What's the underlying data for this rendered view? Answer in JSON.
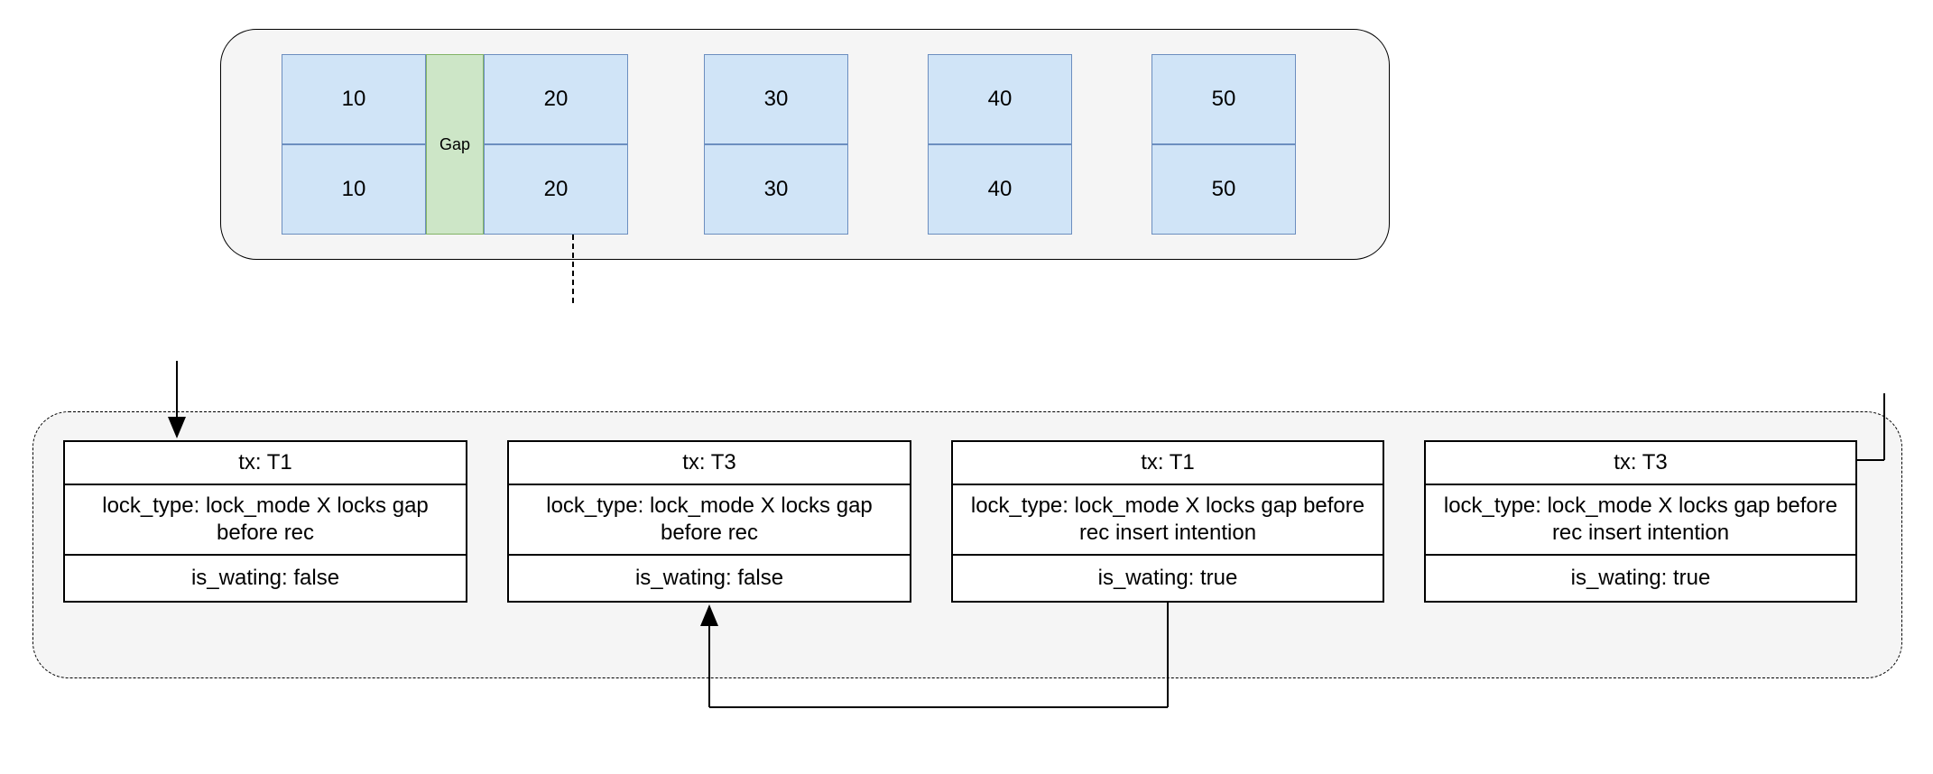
{
  "records": {
    "gap_label": "Gap",
    "columns": [
      {
        "top": "10",
        "bottom": "10"
      },
      {
        "top": "20",
        "bottom": "20"
      },
      {
        "top": "30",
        "bottom": "30"
      },
      {
        "top": "40",
        "bottom": "40"
      },
      {
        "top": "50",
        "bottom": "50"
      }
    ]
  },
  "locks": [
    {
      "tx": "tx: T1",
      "lock_type": "lock_type: lock_mode X locks gap before rec",
      "is_waiting": "is_wating: false"
    },
    {
      "tx": "tx: T3",
      "lock_type": "lock_type: lock_mode X locks gap before rec",
      "is_waiting": "is_wating: false"
    },
    {
      "tx": "tx: T1",
      "lock_type": "lock_type: lock_mode X locks gap before rec insert intention",
      "is_waiting": "is_wating: true"
    },
    {
      "tx": "tx: T3",
      "lock_type": "lock_type: lock_mode X locks gap before rec insert intention",
      "is_waiting": "is_wating: true"
    }
  ]
}
